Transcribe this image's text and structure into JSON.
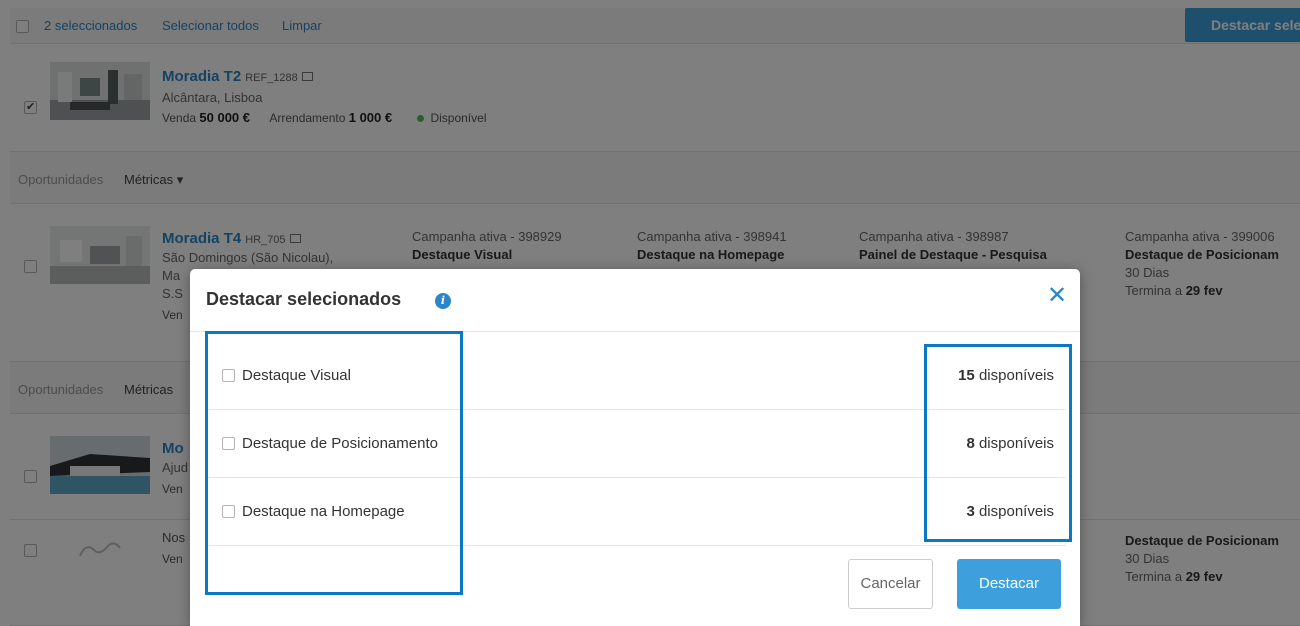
{
  "bulk_bar": {
    "selected_label": "2 seleccionados",
    "select_all": "Selecionar todos",
    "clear": "Limpar",
    "highlight_button": "Destacar sele"
  },
  "properties": [
    {
      "title": "Moradia T2",
      "ref": "REF_1288",
      "location": "Alcântara, Lisboa",
      "sale_label": "Venda",
      "sale_price": "50 000 €",
      "rent_label": "Arrendamento",
      "rent_price": "1 000 €",
      "status": "Disponível",
      "checked": true
    },
    {
      "title": "Moradia T4",
      "ref": "HR_705",
      "location_1": "São Domingos (São Nicolau),",
      "location_2": "Ma",
      "location_3": "S.S",
      "price_fragment": "Ven",
      "checked": false
    },
    {
      "title": "Mo",
      "location": "Ajud",
      "price_fragment": "Ven",
      "checked": false
    },
    {
      "title": "Nos",
      "price_fragment": "Ven",
      "checked": false
    }
  ],
  "sub_bar": {
    "opportunities": "Oportunidades",
    "metrics": "Métricas ▾",
    "metrics_short": "Métricas"
  },
  "campaigns": [
    {
      "status": "Campanha ativa - 398929",
      "name": "Destaque Visual"
    },
    {
      "status": "Campanha ativa - 398941",
      "name": "Destaque na Homepage"
    },
    {
      "status": "Campanha ativa - 398987",
      "name": "Painel de Destaque - Pesquisa"
    },
    {
      "status": "Campanha ativa - 399006",
      "name": "Destaque de Posicionam",
      "duration": "30 Dias",
      "ends_prefix": "Termina a",
      "ends_date": "29 fev"
    }
  ],
  "last_row_campaign": {
    "name": "Destaque de Posicionam",
    "duration": "30 Dias",
    "ends_prefix": "Termina a",
    "ends_date": "29 fev"
  },
  "modal": {
    "title": "Destacar selecionados",
    "info_icon": "info-icon",
    "close_icon": "close-icon",
    "options": [
      {
        "label": "Destaque Visual",
        "count": "15",
        "count_suffix": "disponíveis",
        "checked": false
      },
      {
        "label": "Destaque de Posicionamento",
        "count": "8",
        "count_suffix": "disponíveis",
        "checked": false
      },
      {
        "label": "Destaque na Homepage",
        "count": "3",
        "count_suffix": "disponíveis",
        "checked": false
      }
    ],
    "cancel_label": "Cancelar",
    "submit_label": "Destacar"
  },
  "colors": {
    "link": "#2a86c8",
    "primary_button": "#3da0dc",
    "highlight_box": "#0a78c2",
    "status_available": "#5cb85c"
  }
}
